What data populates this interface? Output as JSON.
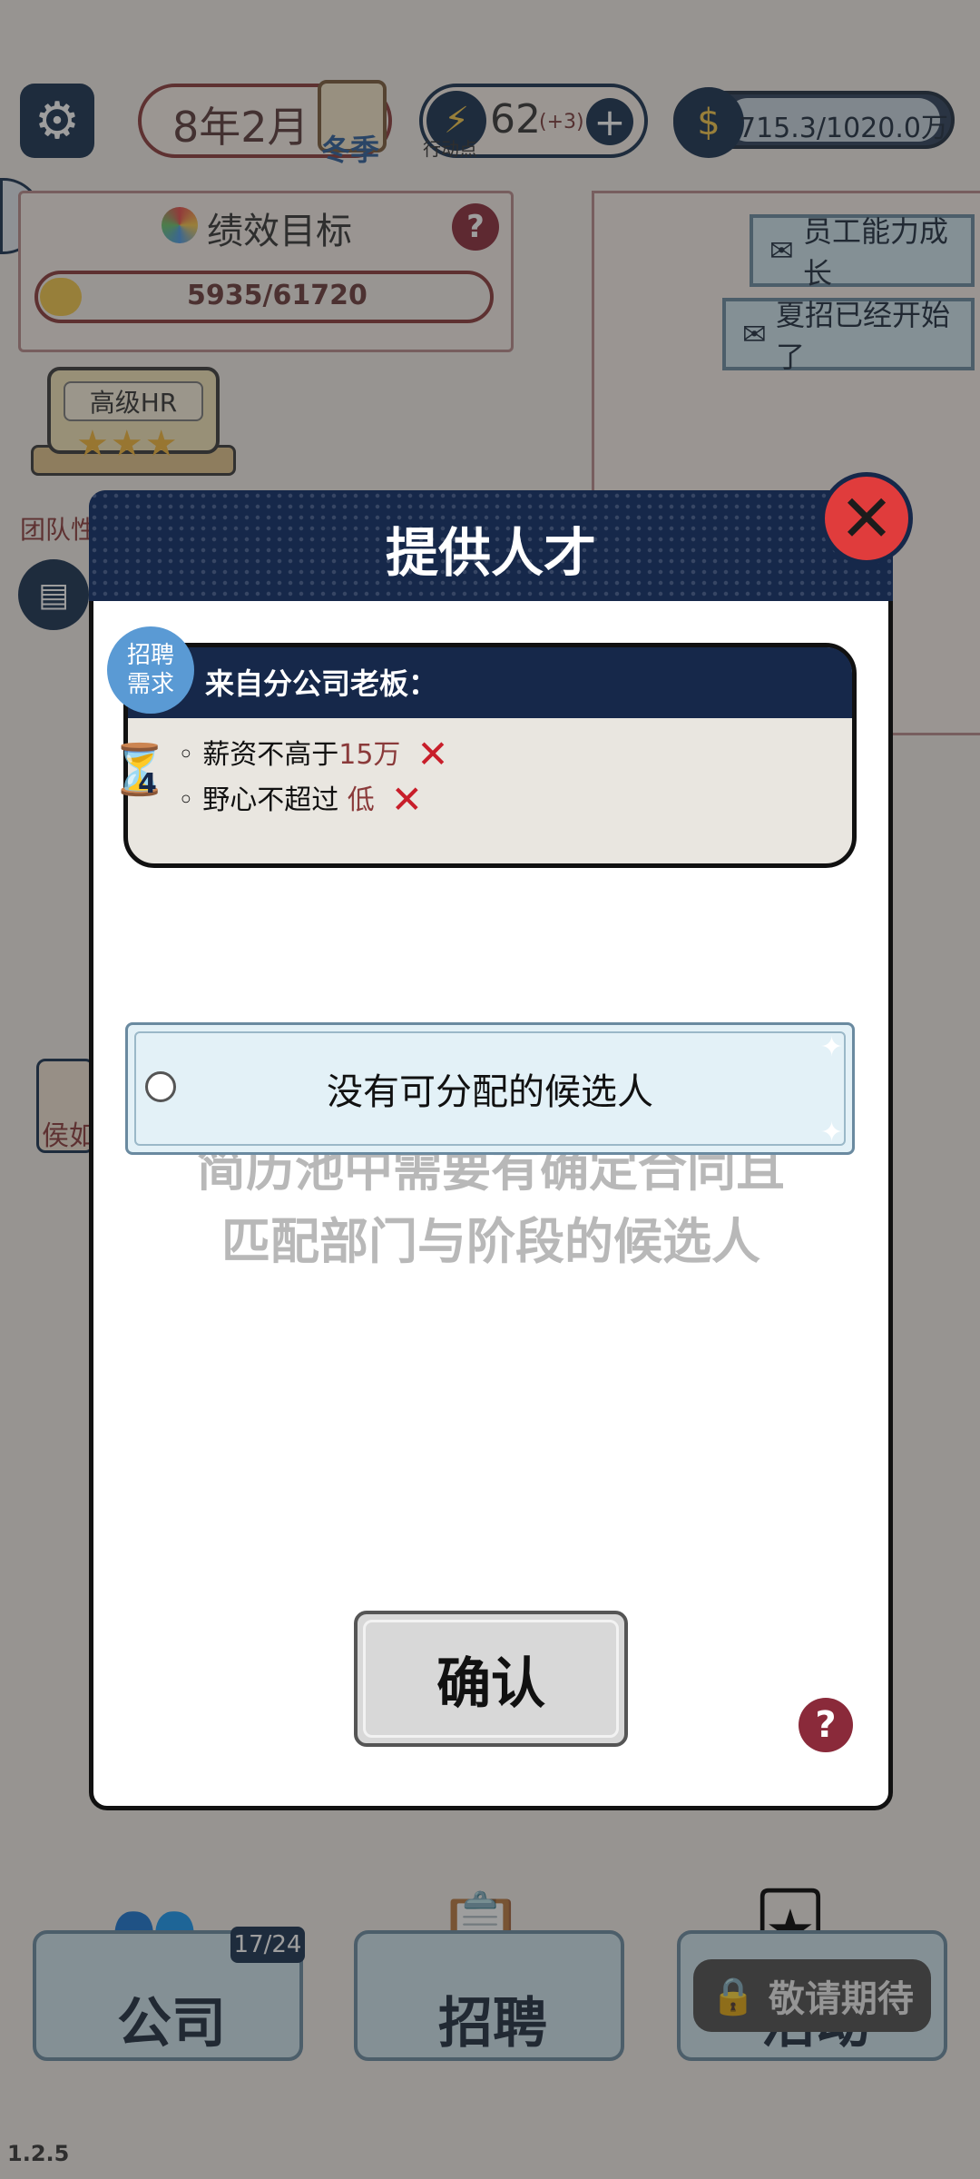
{
  "hud": {
    "date": "8年2月",
    "season": "冬季",
    "action_points": "62",
    "action_points_bonus": "(+3)",
    "action_points_label": "行动点",
    "money": "715.3/1020.0万"
  },
  "performance": {
    "title": "绩效目标",
    "progress_text": "5935/61720",
    "progress_fraction": 0.096
  },
  "mail": {
    "items": [
      {
        "label": "员工能力成长"
      },
      {
        "label": "夏招已经开始了"
      }
    ]
  },
  "hr": {
    "title": "高级HR",
    "stars": "★★★",
    "team_label": "团队性"
  },
  "hired_label": "侯如",
  "modal": {
    "title": "提供人才",
    "badge": "招聘需求",
    "from": "来自分公司老板：",
    "hourglass_count": "4",
    "requirements": [
      {
        "prefix": "◦ 薪资不高于",
        "value": "15万"
      },
      {
        "prefix": "◦ 野心不超过 ",
        "value": "低"
      }
    ],
    "candidate_empty": "没有可分配的候选人",
    "hint_line1": "简历池中需要有确定合同且",
    "hint_line2": "匹配部门与阶段的候选人",
    "confirm": "确认"
  },
  "nav": {
    "company": "公司",
    "company_count": "17/24",
    "recruit": "招聘",
    "events": "活动",
    "locked": "敬请期待"
  },
  "version": "1.2.5",
  "colors": {
    "navy": "#16284a",
    "close_red": "#e03c3c",
    "requirement_highlight": "#8a3a3a",
    "fail_mark": "#c81e2a"
  }
}
